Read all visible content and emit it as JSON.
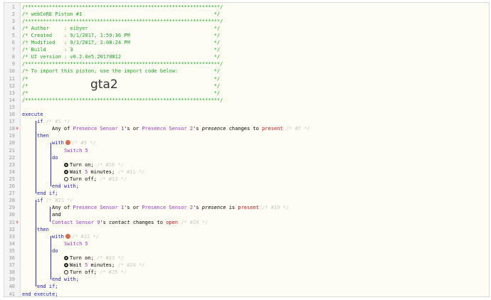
{
  "lines": [
    "/*****************************************************************/",
    "/* webCoRE Piston #1                                            */",
    "/*****************************************************************/",
    "/* Author     : eibyer                                          */",
    "/* Created    : 9/1/2017, 1:59:36 PM                            */",
    "/* Modified   : 9/1/2017, 2:08:24 PM                            */",
    "/* Build      : 3                                               */",
    "/* UI version : v0.2.0e5.20170812                               */",
    "/*****************************************************************/",
    "/* To import this piston, use the import code below:            */",
    "/*                                                              */",
    "/*                                                              */",
    "/*                                                              */",
    "/*****************************************************************/"
  ],
  "import_code": "gta2",
  "code": {
    "execute": "execute",
    "if": "if",
    "c1": "/* #1 */",
    "anyof": "Any of",
    "ps1": "Presence Sensor 1",
    "sor": "'s or",
    "ps2": "Presence Sensor 2",
    "s": "'s",
    "presence": "presence",
    "changes_to": "changes to",
    "present": "present",
    "c7": "/* #7 */",
    "then": "then",
    "with": "with",
    "c9": "/* #9 */",
    "switch5": "Switch 5",
    "do": "do",
    "turn_on": "Turn on;",
    "c10": "/* #10 */",
    "wait": "Wait",
    "five": "5",
    "minutes": "minutes;",
    "c11": "/* #11 */",
    "turn_off": "Turn off;",
    "c12": "/* #12 */",
    "end_with": "end with;",
    "end_if": "end if;",
    "c21": "/* #21 */",
    "is": "is",
    "c19": "/* #19 */",
    "and": "and",
    "cs9": "Contact Sensor 9",
    "contact": "contact",
    "open": "open",
    "c20": "/* #20 */",
    "c22": "/* #22 */",
    "c23": "/* #23 */",
    "c24": "/* #24 */",
    "c25": "/* #25 */",
    "end_execute": "end execute;"
  },
  "line_numbers": [
    "1",
    "2",
    "3",
    "4",
    "5",
    "6",
    "7",
    "8",
    "9",
    "10",
    "11",
    "12",
    "13",
    "14",
    "15",
    "16",
    "17",
    "18",
    "19",
    "20",
    "21",
    "22",
    "23",
    "24",
    "25",
    "26",
    "27",
    "28",
    "29",
    "30",
    "31",
    "32",
    "33",
    "34",
    "35",
    "36",
    "37",
    "38",
    "39",
    "40",
    "41"
  ],
  "breakpoint_marker": "✝"
}
